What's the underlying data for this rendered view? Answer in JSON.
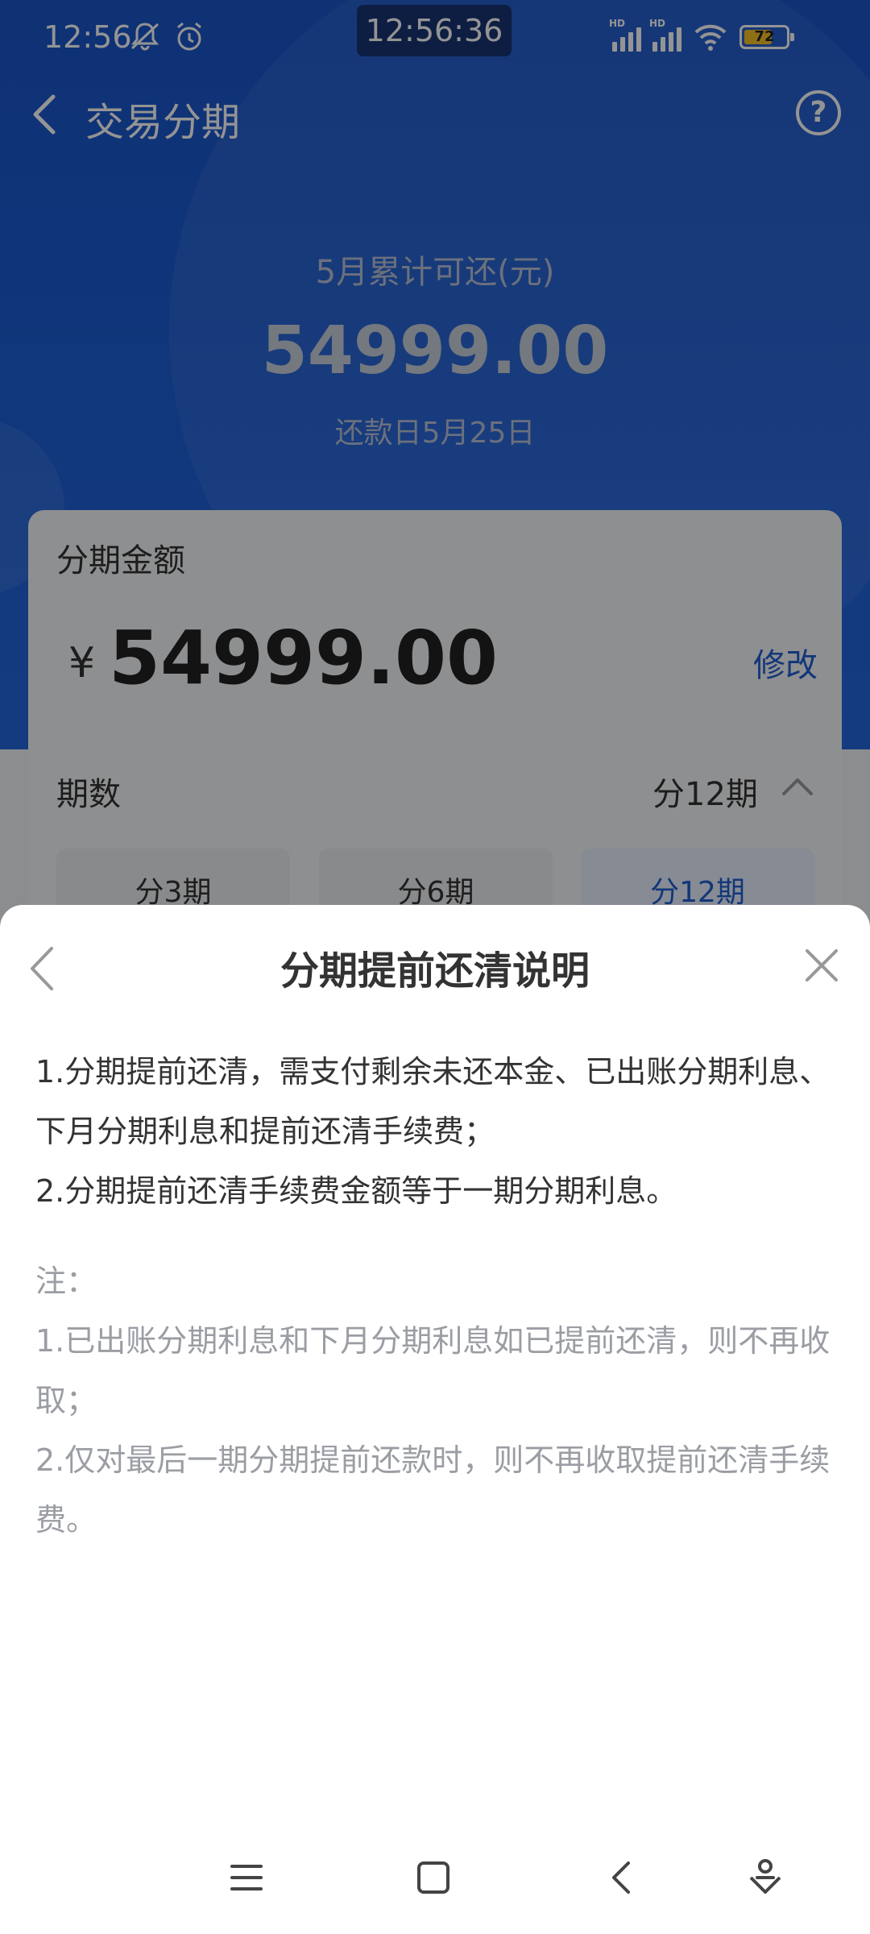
{
  "status_bar": {
    "time": "12:56",
    "clock_overlay": "12:56:36",
    "battery": "72"
  },
  "header": {
    "title": "交易分期"
  },
  "summary": {
    "label": "5月累计可还(元)",
    "amount": "54999.00",
    "due_date": "还款日5月25日"
  },
  "card": {
    "amount_label": "分期金额",
    "currency": "¥",
    "amount": "54999.00",
    "edit_label": "修改",
    "periods_label": "期数",
    "periods_value": "分12期",
    "options": [
      {
        "label": "分3期",
        "selected": false
      },
      {
        "label": "分6期",
        "selected": false
      },
      {
        "label": "分12期",
        "selected": true
      }
    ]
  },
  "sheet": {
    "title": "分期提前还清说明",
    "description": [
      "1.分期提前还清，需支付剩余未还本金、已出账分期利息、下月分期利息和提前还清手续费；",
      "2.分期提前还清手续费金额等于一期分期利息。"
    ],
    "note_title": "注：",
    "notes": [
      "1.已出账分期利息和下月分期利息如已提前还清，则不再收取；",
      "2.仅对最后一期分期提前还款时，则不再收取提前还清手续费。"
    ]
  },
  "colors": {
    "primary_blue": "#1a56c9",
    "link_blue": "#1f5fd0",
    "note_gray": "#9a9da3"
  }
}
